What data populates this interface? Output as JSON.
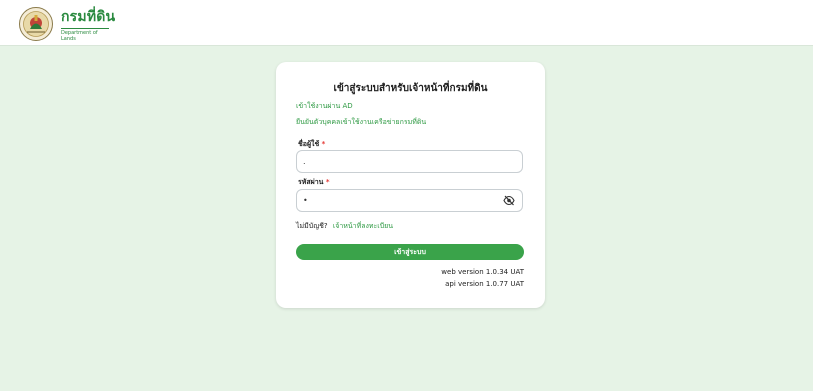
{
  "header": {
    "brand_name": "กรมที่ดิน",
    "brand_sub": "Department of Lands",
    "logo_icon": "department-of-lands-seal"
  },
  "login": {
    "title": "เข้าสู่ระบบสำหรับเจ้าหน้าที่กรมที่ดิน",
    "ad_link": "เข้าใช้งานผ่าน AD",
    "verify_link": "ยืนยันตัวบุคคลเข้าใช้งานเครือข่ายกรมที่ดิน",
    "username_label": "ชื่อผู้ใช้",
    "username_value": ".",
    "password_label": "รหัสผ่าน",
    "password_value": "•",
    "required_mark": "*",
    "no_account_text": "ไม่มีบัญชี?",
    "register_link": "เจ้าหน้าที่ลงทะเบียน",
    "login_button": "เข้าสู่ระบบ",
    "toggle_icon": "eye-slash-icon"
  },
  "versions": {
    "web": "web version 1.0.34 UAT",
    "api": "api version 1.0.77 UAT"
  },
  "colors": {
    "background": "#e6f3e6",
    "brand_green": "#2a8a3f",
    "link_green": "#2f9a44",
    "button_green": "#3aa34a",
    "required_red": "#e53935"
  }
}
